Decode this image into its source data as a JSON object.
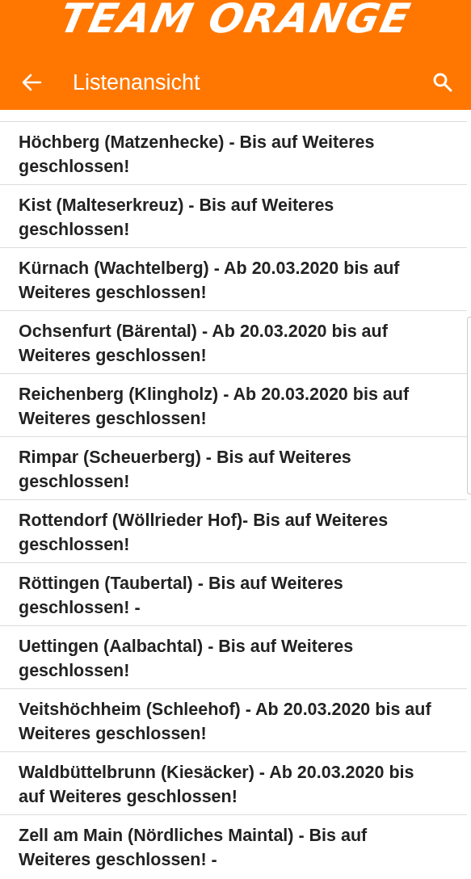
{
  "logo": "TEAM ORANGE",
  "toolbar": {
    "title": "Listenansicht"
  },
  "items": [
    {
      "text": "Höchberg (Matzenhecke) - Bis auf Weiteres geschlossen!"
    },
    {
      "text": "Kist (Malteserkreuz) - Bis auf Weiteres geschlossen!"
    },
    {
      "text": "Kürnach (Wachtelberg) - Ab 20.03.2020 bis auf Weiteres geschlossen!"
    },
    {
      "text": "Ochsenfurt (Bärental) - Ab 20.03.2020 bis auf Weiteres geschlossen!"
    },
    {
      "text": "Reichenberg (Klingholz) - Ab 20.03.2020 bis auf Weiteres geschlossen!"
    },
    {
      "text": "Rimpar (Scheuerberg) - Bis auf Weiteres geschlossen!"
    },
    {
      "text": "Rottendorf (Wöllrieder Hof)-  Bis auf Weiteres geschlossen!"
    },
    {
      "text": "Röttingen (Taubertal) - Bis auf Weiteres geschlossen! -"
    },
    {
      "text": "Uettingen (Aalbachtal) - Bis auf Weiteres geschlossen!"
    },
    {
      "text": "Veitshöchheim (Schleehof) - Ab 20.03.2020 bis auf Weiteres geschlossen!"
    },
    {
      "text": "Waldbüttelbrunn (Kiesäcker) - Ab 20.03.2020 bis auf Weiteres geschlossen!"
    },
    {
      "text": "Zell am Main (Nördliches Maintal) - Bis auf Weiteres geschlossen! -"
    }
  ]
}
